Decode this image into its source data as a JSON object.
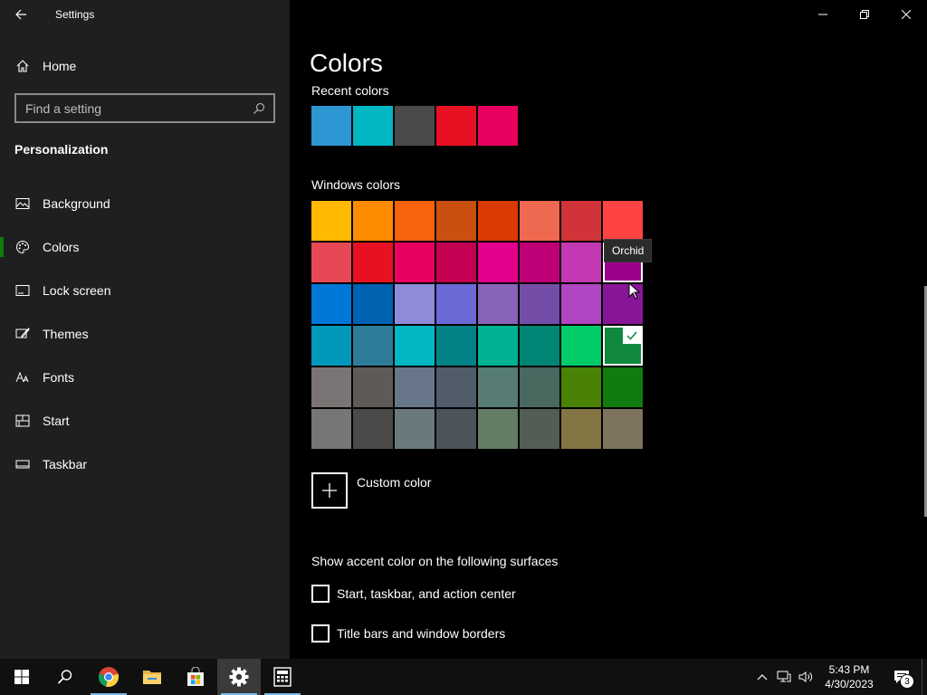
{
  "app": {
    "title": "Settings"
  },
  "sidebar": {
    "home_label": "Home",
    "search_placeholder": "Find a setting",
    "section_heading": "Personalization",
    "items": [
      {
        "label": "Background",
        "icon": "image-icon",
        "active": false
      },
      {
        "label": "Colors",
        "icon": "palette-icon",
        "active": true
      },
      {
        "label": "Lock screen",
        "icon": "lock-screen-icon",
        "active": false
      },
      {
        "label": "Themes",
        "icon": "themes-icon",
        "active": false
      },
      {
        "label": "Fonts",
        "icon": "fonts-icon",
        "active": false
      },
      {
        "label": "Start",
        "icon": "start-icon",
        "active": false
      },
      {
        "label": "Taskbar",
        "icon": "taskbar-icon",
        "active": false
      }
    ]
  },
  "main": {
    "title": "Colors",
    "recent_label": "Recent colors",
    "recent_colors": [
      "#2d96d3",
      "#00b7c3",
      "#4c4a48",
      "#e81123",
      "#ea005e"
    ],
    "windows_label": "Windows colors",
    "windows_colors": [
      [
        "#ffb900",
        "#ff8c00",
        "#f7630c",
        "#ca5010",
        "#da3b01",
        "#ef6950",
        "#d13438",
        "#ff4343"
      ],
      [
        "#e74856",
        "#e81123",
        "#ea005e",
        "#c30052",
        "#e3008c",
        "#bf0077",
        "#c239b3",
        "#9a0089"
      ],
      [
        "#0078d7",
        "#0063b1",
        "#8e8cd8",
        "#6b69d6",
        "#8764b8",
        "#744da9",
        "#b146c2",
        "#881798"
      ],
      [
        "#0099bc",
        "#2d7d9a",
        "#00b7c3",
        "#038387",
        "#00b294",
        "#018574",
        "#00cc6a",
        "#10893e"
      ],
      [
        "#7a7574",
        "#5d5a58",
        "#68768a",
        "#515c6b",
        "#567c73",
        "#486860",
        "#498205",
        "#107c10"
      ],
      [
        "#767676",
        "#4c4a48",
        "#69797e",
        "#4a5459",
        "#647c64",
        "#525e54",
        "#847545",
        "#7e735f"
      ]
    ],
    "selected_color": {
      "row": 3,
      "col": 7
    },
    "hovered_color": {
      "row": 1,
      "col": 7
    },
    "tooltip": "Orchid",
    "custom_color_label": "Custom color",
    "surfaces_label": "Show accent color on the following surfaces",
    "checkboxes": [
      {
        "label": "Start, taskbar, and action center",
        "checked": false
      },
      {
        "label": "Title bars and window borders",
        "checked": false
      }
    ]
  },
  "taskbar": {
    "apps": [
      "windows-start-icon",
      "search-icon",
      "chrome-icon",
      "file-explorer-icon",
      "store-icon",
      "settings-icon",
      "calculator-icon"
    ],
    "time": "5:43 PM",
    "date": "4/30/2023",
    "notification_count": "3"
  },
  "colors": {
    "accent": "#107c10",
    "sidebar_bg": "#1f1f1f",
    "main_bg": "#000000"
  }
}
